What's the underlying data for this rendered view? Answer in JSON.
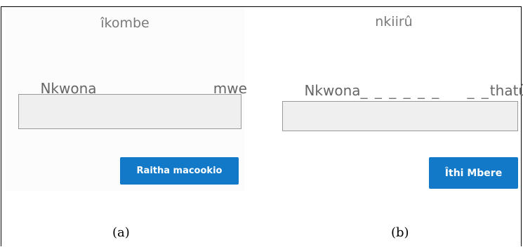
{
  "panel_a": {
    "word": "îkombe",
    "sentence_prefix": "Nkwona",
    "gap_long": "_ _ _ _ _ _",
    "gap_short": "_ _",
    "sentence_suffix": "mwe",
    "answer_value": "",
    "button_label": "Raitha macookio",
    "caption": "(a)"
  },
  "panel_b": {
    "word": "nkiirû",
    "sentence_prefix": "Nkwona",
    "gap_long": "_ _ _ _ _ _",
    "gap_short": "_ _",
    "sentence_suffix": "thatû.",
    "answer_value": "",
    "button_label": "Îthi Mbere",
    "caption": "(b)"
  },
  "colors": {
    "button": "#1278c8",
    "answer_box": "#efefef",
    "prompt_text": "#7a7a7a"
  }
}
